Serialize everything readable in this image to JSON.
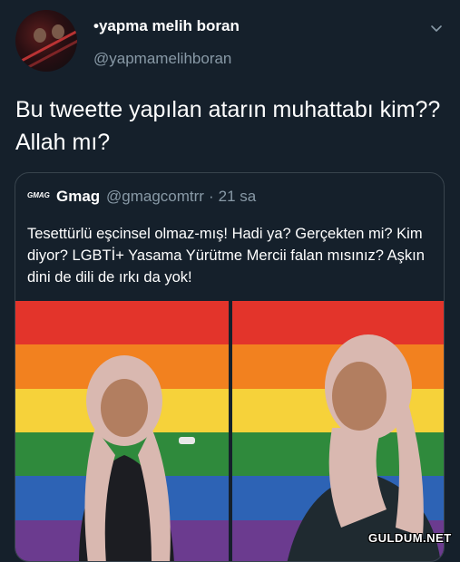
{
  "author": {
    "display_name": "•yapma melih boran",
    "handle": "@yapmamelihboran"
  },
  "tweet": {
    "text": "Bu tweette yapılan atarın muhattabı kim?? Allah mı?"
  },
  "quoted_tweet": {
    "logo_text": "GMAG",
    "name": "Gmag",
    "handle": "@gmagcomtrr",
    "separator": "·",
    "time": "21 sa",
    "text": "Tesettürlü eşcinsel olmaz-mış! Hadi ya? Gerçekten mi? Kim diyor? LGBTİ+ Yasama Yürütme Mercii falan mısınız? Aşkın dini de dili de ırkı da yok!"
  },
  "watermark": "GULDUM.NET",
  "icons": {
    "more": "chevron-down-icon"
  },
  "colors": {
    "background": "#15202b",
    "secondary_text": "#8899a6",
    "border": "#38444d",
    "flag": [
      "#e3342b",
      "#f2811f",
      "#f6d23a",
      "#2f8a3c",
      "#2d63b5",
      "#6b3b8f"
    ]
  }
}
